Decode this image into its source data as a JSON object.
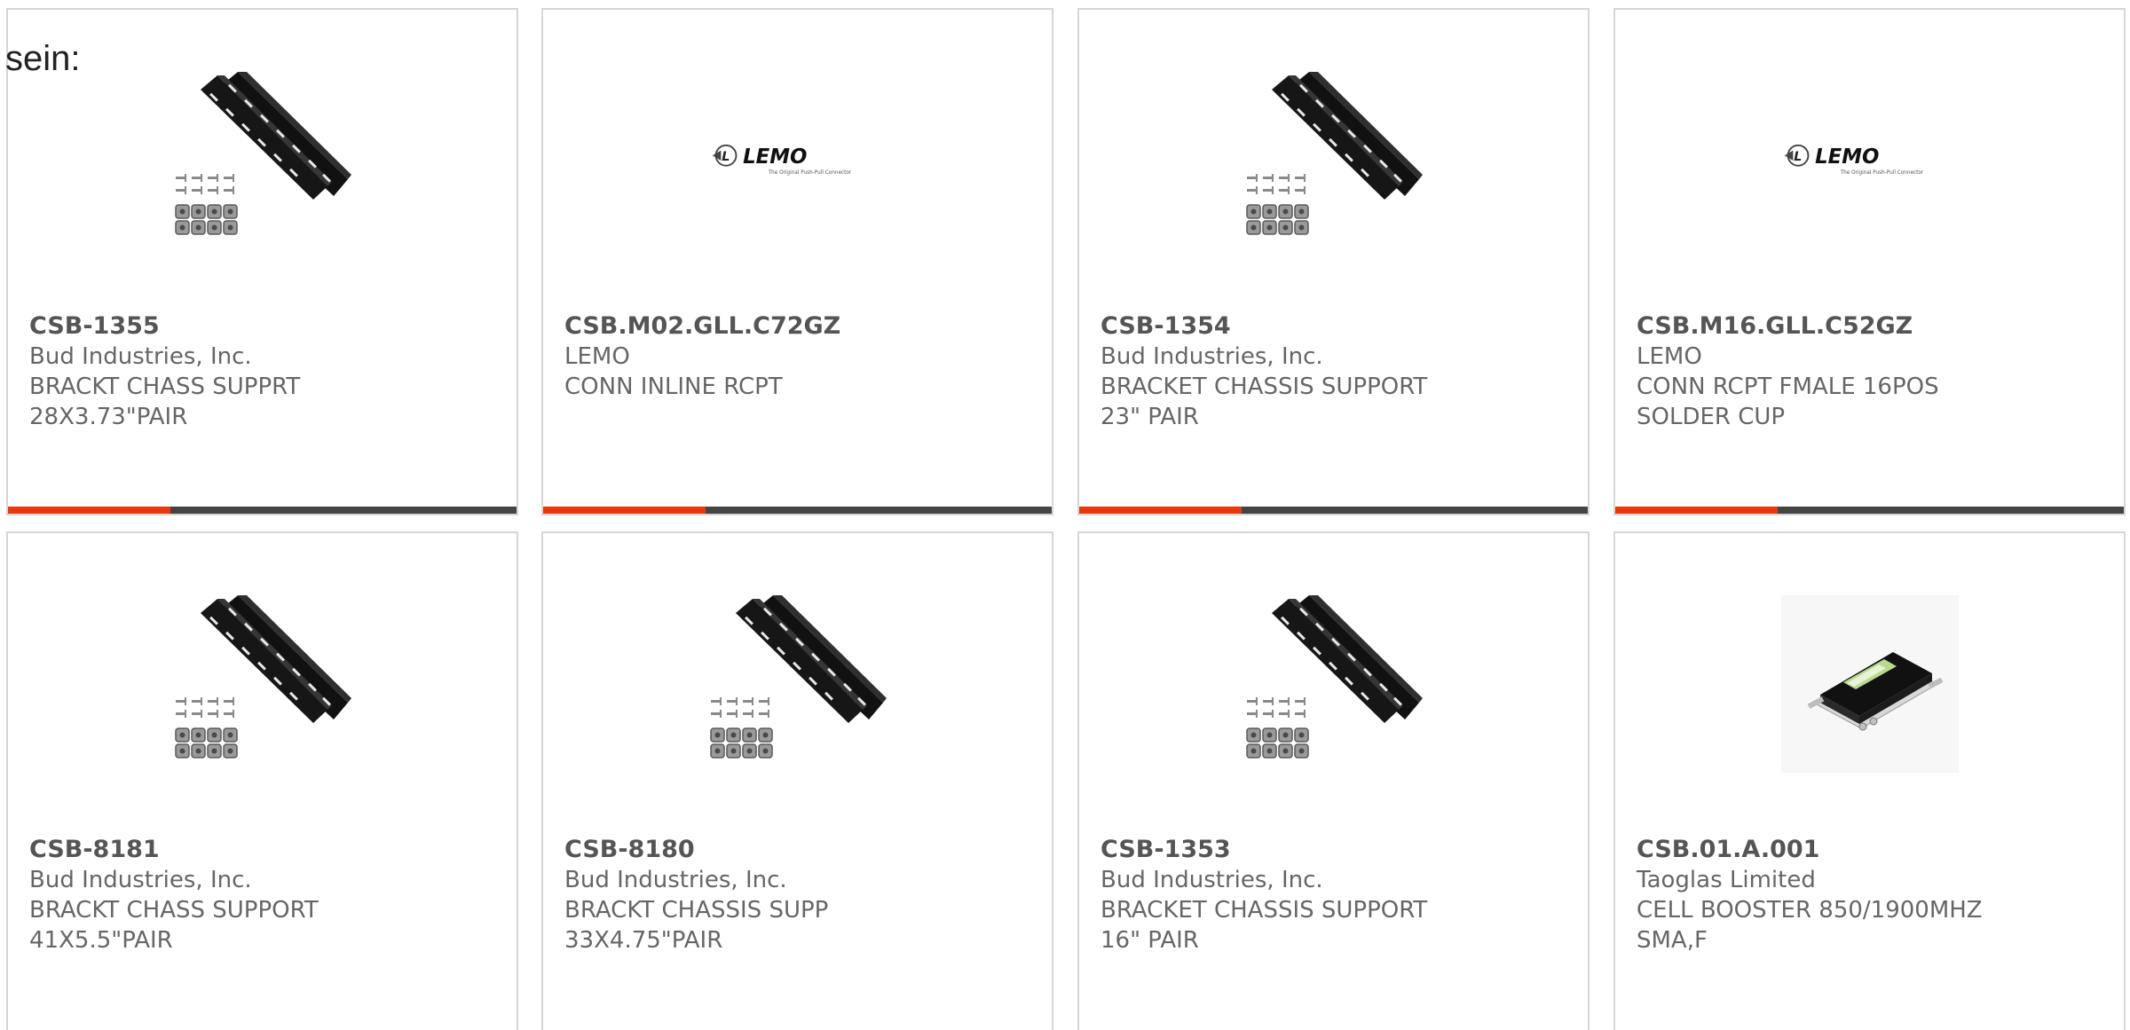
{
  "lead_text": "sein:",
  "colors": {
    "accent": "#e8380d",
    "bar": "#444444",
    "border": "#d6d6d6",
    "title_text": "#555555",
    "body_text": "#666666"
  },
  "products": [
    {
      "part_number": "CSB-1355",
      "manufacturer": "Bud Industries, Inc.",
      "description": "BRACKT CHASS SUPPRT 28X3.73\"PAIR",
      "image_icon": "chassis-bracket-icon"
    },
    {
      "part_number": "CSB.M02.GLL.C72GZ",
      "manufacturer": "LEMO",
      "description": "CONN INLINE RCPT",
      "image_icon": "lemo-logo",
      "logo_text": "LEMO",
      "logo_tagline": "The Original Push-Pull Connector"
    },
    {
      "part_number": "CSB-1354",
      "manufacturer": "Bud Industries, Inc.",
      "description": "BRACKET CHASSIS SUPPORT 23\" PAIR",
      "image_icon": "chassis-bracket-icon"
    },
    {
      "part_number": "CSB.M16.GLL.C52GZ",
      "manufacturer": "LEMO",
      "description": "CONN RCPT FMALE 16POS SOLDER CUP",
      "image_icon": "lemo-logo",
      "logo_text": "LEMO",
      "logo_tagline": "The Original Push-Pull Connector"
    },
    {
      "part_number": "CSB-8181",
      "manufacturer": "Bud Industries, Inc.",
      "description": "BRACKT CHASS SUPPORT 41X5.5\"PAIR",
      "image_icon": "chassis-bracket-icon"
    },
    {
      "part_number": "CSB-8180",
      "manufacturer": "Bud Industries, Inc.",
      "description": "BRACKT CHASSIS SUPP 33X4.75\"PAIR",
      "image_icon": "chassis-bracket-icon"
    },
    {
      "part_number": "CSB-1353",
      "manufacturer": "Bud Industries, Inc.",
      "description": "BRACKET CHASSIS SUPPORT 16\" PAIR",
      "image_icon": "chassis-bracket-icon"
    },
    {
      "part_number": "CSB.01.A.001",
      "manufacturer": "Taoglas Limited",
      "description": "CELL BOOSTER 850/1900MHZ SMA,F",
      "image_icon": "cell-booster-icon"
    }
  ]
}
